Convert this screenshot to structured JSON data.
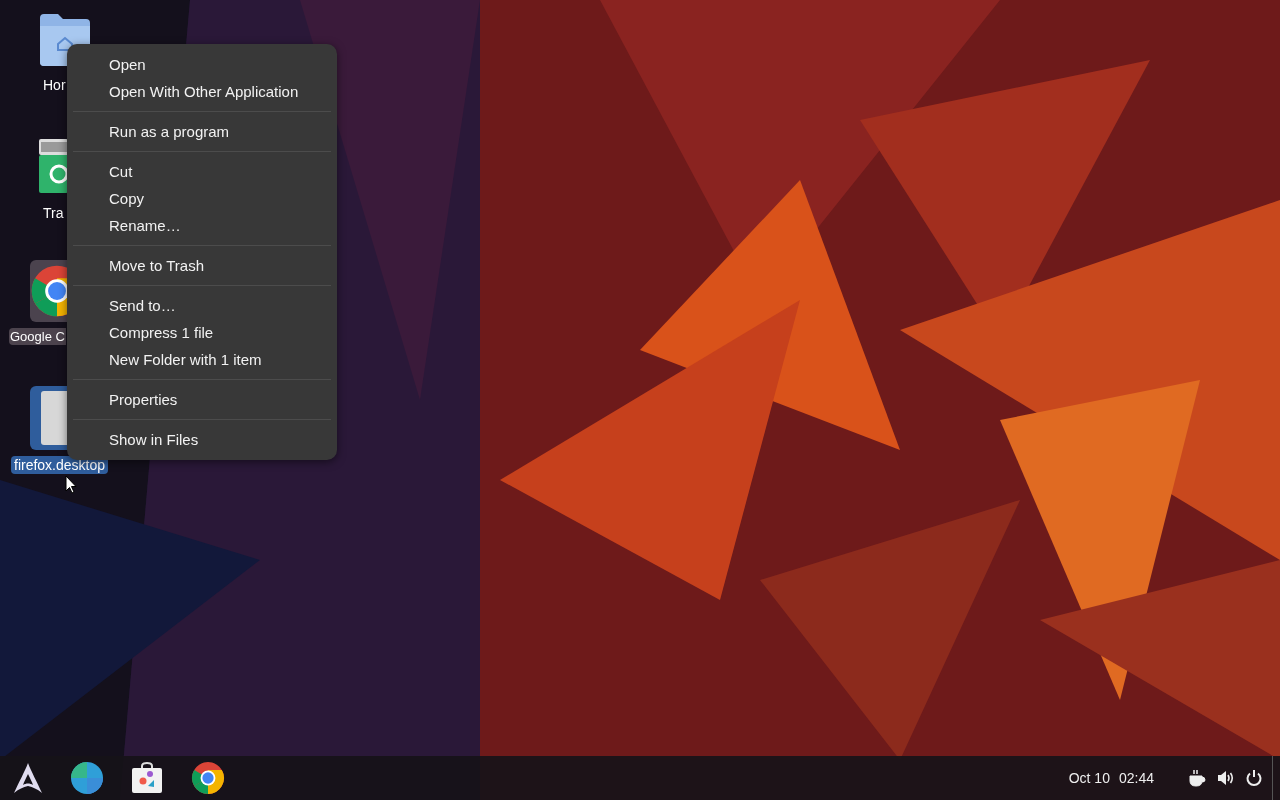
{
  "desktop_icons": [
    {
      "label": "Hor",
      "kind": "folder",
      "selected": false,
      "highlighted": false
    },
    {
      "label": "Tra",
      "kind": "trash",
      "selected": false,
      "highlighted": false
    },
    {
      "label": "Google C",
      "kind": "chrome",
      "selected": false,
      "highlighted": true
    },
    {
      "label": "firefox.desktop",
      "kind": "file",
      "selected": true,
      "highlighted": false
    }
  ],
  "context_menu": {
    "groups": [
      [
        "Open",
        "Open With Other Application"
      ],
      [
        "Run as a program"
      ],
      [
        "Cut",
        "Copy",
        "Rename…"
      ],
      [
        "Move to Trash"
      ],
      [
        "Send to…",
        "Compress 1 file",
        "New Folder with 1 item"
      ],
      [
        "Properties"
      ],
      [
        "Show in Files"
      ]
    ]
  },
  "taskbar": {
    "launchers": [
      {
        "kind": "arch"
      },
      {
        "kind": "globe"
      },
      {
        "kind": "store"
      },
      {
        "kind": "chrome"
      }
    ],
    "date": "Oct 10",
    "time": "02:44"
  }
}
